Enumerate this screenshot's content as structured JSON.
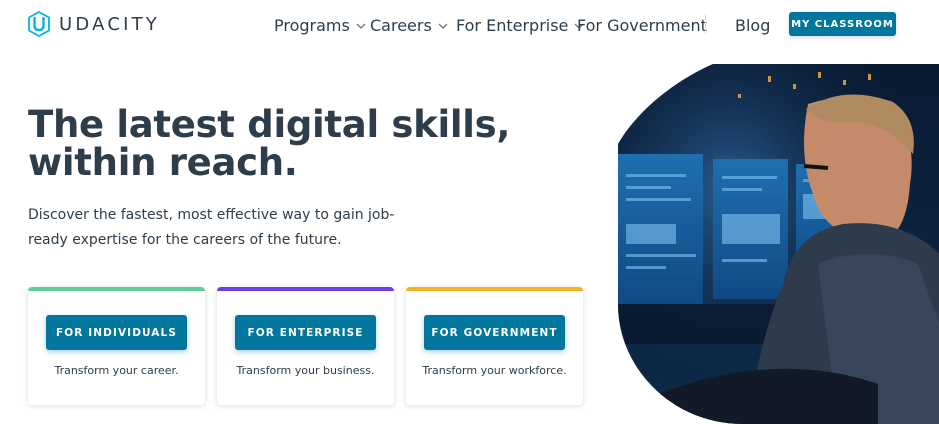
{
  "brand": {
    "name": "UDACITY",
    "color": "#02b3e4"
  },
  "nav": {
    "items": [
      {
        "label": "Programs",
        "dropdown": true
      },
      {
        "label": "Careers",
        "dropdown": true
      },
      {
        "label": "For Enterprise",
        "dropdown": true
      },
      {
        "label": "For Government",
        "dropdown": false
      }
    ],
    "blog": "Blog",
    "classroom_button": "MY CLASSROOM"
  },
  "hero": {
    "headline_line1": "The latest digital skills,",
    "headline_line2": "within reach.",
    "subtext": "Discover the fastest, most effective way to gain job-ready expertise for the careers of the future."
  },
  "cards": [
    {
      "button": "FOR INDIVIDUALS",
      "caption": "Transform your career.",
      "accent": "#5ad09a"
    },
    {
      "button": "FOR ENTERPRISE",
      "caption": "Transform your business.",
      "accent": "#6e3fe8"
    },
    {
      "button": "FOR GOVERNMENT",
      "caption": "Transform your workforce.",
      "accent": "#f5b120"
    }
  ],
  "colors": {
    "primary_button": "#02779e",
    "heading": "#2e3d49"
  },
  "hero_image": {
    "subject": "person-at-monitors-photo"
  }
}
